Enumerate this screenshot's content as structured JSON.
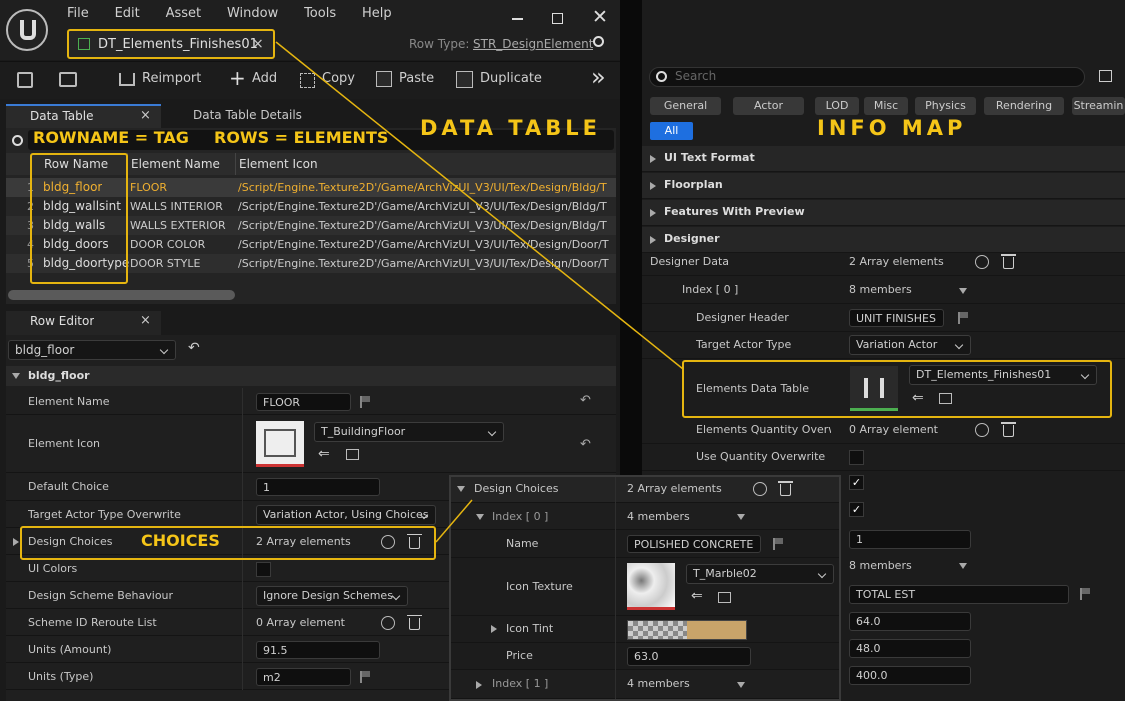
{
  "menu": [
    "File",
    "Edit",
    "Asset",
    "Window",
    "Tools",
    "Help"
  ],
  "doc_tab": {
    "label": "DT_Elements_Finishes01",
    "close": "×"
  },
  "row_type": {
    "label": "Row Type:",
    "value": "STR_DesignElement"
  },
  "toolbar": {
    "reimport": "Reimport",
    "add": "Add",
    "copy": "Copy",
    "paste": "Paste",
    "duplicate": "Duplicate"
  },
  "tabs": {
    "data_table": "Data Table",
    "details": "Data Table Details",
    "close": "×",
    "row_editor": "Row Editor"
  },
  "annotations": {
    "rowname": "ROWNAME = TAG",
    "rows": "ROWS = ELEMENTS",
    "data_table": "DATA TABLE",
    "info_map": "INFO MAP",
    "choices": "CHOICES"
  },
  "table": {
    "headers": [
      "Row Name",
      "Element Name",
      "Element Icon"
    ],
    "rows": [
      {
        "n": "1",
        "name": "bldg_floor",
        "el": "FLOOR",
        "icon": "/Script/Engine.Texture2D'/Game/ArchVizUI_V3/UI/Tex/Design/Bldg/T"
      },
      {
        "n": "2",
        "name": "bldg_wallsint",
        "el": "WALLS INTERIOR",
        "icon": "/Script/Engine.Texture2D'/Game/ArchVizUI_V3/UI/Tex/Design/Bldg/T"
      },
      {
        "n": "3",
        "name": "bldg_walls",
        "el": "WALLS EXTERIOR",
        "icon": "/Script/Engine.Texture2D'/Game/ArchVizUI_V3/UI/Tex/Design/Bldg/T"
      },
      {
        "n": "4",
        "name": "bldg_doors",
        "el": "DOOR COLOR",
        "icon": "/Script/Engine.Texture2D'/Game/ArchVizUI_V3/UI/Tex/Design/Door/T"
      },
      {
        "n": "5",
        "name": "bldg_doortype",
        "el": "DOOR STYLE",
        "icon": "/Script/Engine.Texture2D'/Game/ArchVizUI_V3/UI/Tex/Design/Door/T"
      }
    ]
  },
  "row_editor": {
    "selected": "bldg_floor",
    "header": "bldg_floor",
    "element_name": {
      "label": "Element Name",
      "value": "FLOOR"
    },
    "element_icon": {
      "label": "Element Icon",
      "value": "T_BuildingFloor"
    },
    "default_choice": {
      "label": "Default Choice",
      "value": "1"
    },
    "target_override": {
      "label": "Target Actor Type Overwrite",
      "value": "Variation Actor, Using Choices"
    },
    "design_choices": {
      "label": "Design Choices",
      "value": "2 Array elements"
    },
    "ui_colors": {
      "label": "UI Colors"
    },
    "scheme_behaviour": {
      "label": "Design Scheme Behaviour",
      "value": "Ignore Design Schemes"
    },
    "scheme_reroute": {
      "label": "Scheme ID Reroute List",
      "value": "0 Array element"
    },
    "units_amount": {
      "label": "Units (Amount)",
      "value": "91.5"
    },
    "units_type": {
      "label": "Units (Type)",
      "value": "m2"
    }
  },
  "popup": {
    "design_choices": "Design Choices",
    "count": "2 Array elements",
    "index0": "Index [ 0 ]",
    "members0": "4 members",
    "name_label": "Name",
    "name_value": "POLISHED CONCRETE",
    "icon_label": "Icon Texture",
    "icon_value": "T_Marble02",
    "tint_label": "Icon Tint",
    "tint_color": "#c9a46a",
    "price_label": "Price",
    "price_value": "63.0",
    "index1": "Index [ 1 ]",
    "members1": "4 members"
  },
  "right": {
    "search_placeholder": "Search",
    "filters": [
      "General",
      "Actor",
      "LOD",
      "Misc",
      "Physics",
      "Rendering",
      "Streamin"
    ],
    "all": "All",
    "categories": [
      "UI Text Format",
      "Floorplan",
      "Features With Preview",
      "Designer"
    ],
    "designer_data": {
      "label": "Designer Data",
      "value": "2 Array elements"
    },
    "index0": {
      "label": "Index [ 0 ]",
      "value": "8 members"
    },
    "designer_header": {
      "label": "Designer Header",
      "value": "UNIT FINISHES"
    },
    "target_actor": {
      "label": "Target Actor Type",
      "value": "Variation Actor"
    },
    "elements_dt": {
      "label": "Elements Data Table",
      "value": "DT_Elements_Finishes01"
    },
    "qty_override": {
      "label": "Elements Quantity Overwr...",
      "value": "0 Array element"
    },
    "use_qty": {
      "label": "Use Quantity Overwrite"
    },
    "val_1": "1",
    "members8": "8 members",
    "total_est": "TOTAL EST",
    "v64": "64.0",
    "v48": "48.0",
    "v400": "400.0"
  }
}
